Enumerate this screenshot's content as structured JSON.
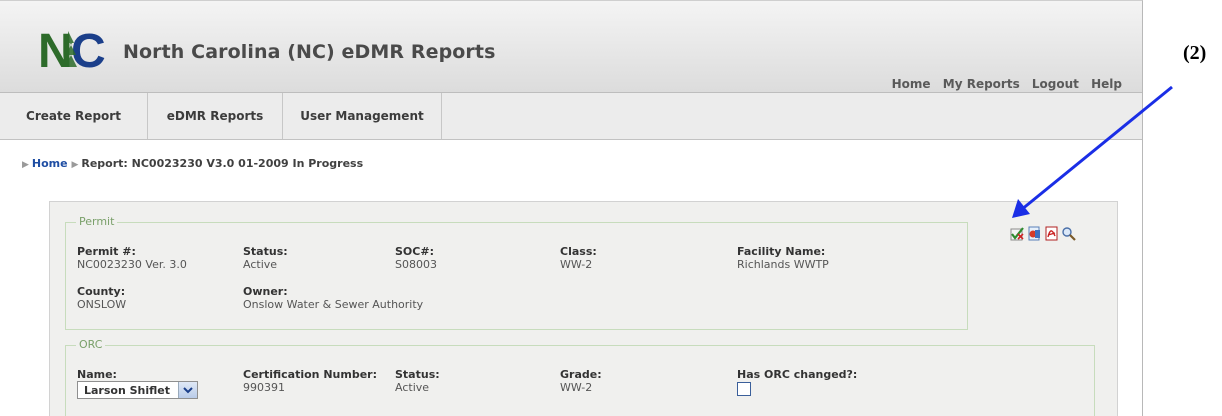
{
  "app": {
    "logo_text": "NC",
    "title": "North Carolina (NC) eDMR Reports"
  },
  "top_links": [
    "Home",
    "My Reports",
    "Logout",
    "Help"
  ],
  "tabs": [
    "Create Report",
    "eDMR Reports",
    "User Management"
  ],
  "breadcrumb": {
    "home": "Home",
    "current": "Report: NC0023230 V3.0 01-2009 In Progress"
  },
  "permit": {
    "legend": "Permit",
    "permit_label": "Permit #:",
    "permit_value": "NC0023230 Ver. 3.0",
    "status_label": "Status:",
    "status_value": "Active",
    "soc_label": "SOC#:",
    "soc_value": "S08003",
    "class_label": "Class:",
    "class_value": "WW-2",
    "facility_label": "Facility Name:",
    "facility_value": "Richlands WWTP",
    "county_label": "County:",
    "county_value": "ONSLOW",
    "owner_label": "Owner:",
    "owner_value": "Onslow Water & Sewer Authority"
  },
  "orc": {
    "legend": "ORC",
    "name_label": "Name:",
    "name_selected": "Larson Shiflet",
    "cert_label": "Certification Number:",
    "cert_value": "990391",
    "status_label": "Status:",
    "status_value": "Active",
    "grade_label": "Grade:",
    "grade_value": "WW-2",
    "changed_label": "Has ORC changed?:",
    "changed_checked": false
  },
  "toolbar_icons": [
    "check-report-icon",
    "save-report-icon",
    "pdf-icon",
    "search-icon"
  ],
  "annotation": {
    "label": "(2)",
    "color": "#1a2ee6"
  }
}
